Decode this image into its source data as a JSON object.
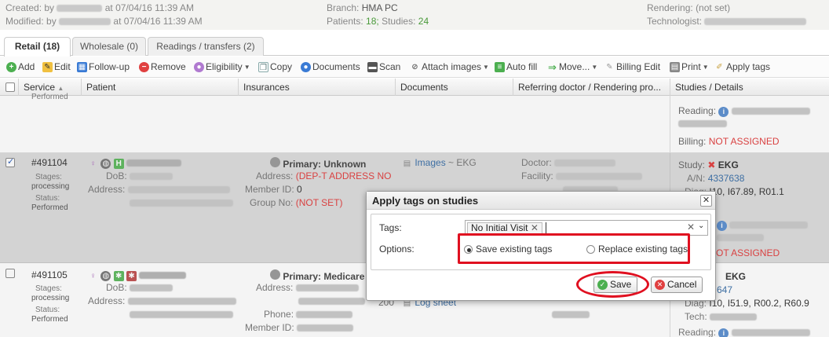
{
  "header": {
    "created_label": "Created:",
    "created_by": "by",
    "created_date": "at 07/04/16 11:39 AM",
    "modified_label": "Modified:",
    "modified_by": "by",
    "modified_date": "at 07/04/16 11:39 AM",
    "branch_label": "Branch:",
    "branch_value": "HMA PC",
    "patients_label": "Patients:",
    "patients_value": "18;",
    "studies_label": "Studies:",
    "studies_value": "24",
    "rendering_label": "Rendering:",
    "rendering_value": "(not set)",
    "technologist_label": "Technologist:"
  },
  "tabs": [
    {
      "label": "Retail (18)"
    },
    {
      "label": "Wholesale (0)"
    },
    {
      "label": "Readings / transfers (2)"
    }
  ],
  "toolbar": {
    "add": "Add",
    "edit": "Edit",
    "followup": "Follow-up",
    "remove": "Remove",
    "eligibility": "Eligibility",
    "copy": "Copy",
    "documents": "Documents",
    "scan": "Scan",
    "attach": "Attach images",
    "autofill": "Auto fill",
    "move": "Move...",
    "billing": "Billing Edit",
    "print": "Print",
    "applytags": "Apply tags"
  },
  "grid": {
    "columns": [
      "Service",
      "Patient",
      "Insurances",
      "Documents",
      "Referring doctor / Rendering pro...",
      "Studies / Details"
    ]
  },
  "row0": {
    "status_partial": "Performed",
    "reading_label": "Reading:",
    "billing_label": "Billing:",
    "billing_value": "NOT ASSIGNED"
  },
  "row1": {
    "id": "#491104",
    "stages_label": "Stages:",
    "stages_value": "processing",
    "status_label": "Status:",
    "status_value": "Performed",
    "dob_label": "DoB:",
    "address_label": "Address:",
    "ins_primary": "Primary: Unknown",
    "ins_address_label": "Address:",
    "ins_address_value": "(DEP-T ADDRESS NO",
    "ins_member_label": "Member ID:",
    "ins_member_value": "0",
    "ins_group_label": "Group No:",
    "ins_group_value": "(NOT SET)",
    "doc_images": "Images",
    "doc_ekg": "~ EKG",
    "doctor_label": "Doctor:",
    "facility_label": "Facility:",
    "study_label": "Study:",
    "study_value": "EKG",
    "an_label": "A/N:",
    "an_value": "4337638",
    "diag_label": "Diag:",
    "diag_value": "I10, I67.89, R01.1",
    "not_assigned": "OT ASSIGNED"
  },
  "row2": {
    "id": "#491105",
    "stages_label": "Stages:",
    "stages_value": "processing",
    "status_label": "Status:",
    "status_value": "Performed",
    "dob_label": "DoB:",
    "address_label": "Address:",
    "ins_primary": "Primary: Medicare",
    "ins_address_label": "Address:",
    "ins_phone_label": "Phone:",
    "ins_member_label": "Member ID:",
    "doc_logsheet": "Log sheet",
    "doc_partial": "200",
    "study_value": "EKG",
    "an_value": "647",
    "diag_label": "Diag:",
    "diag_value": "I10, I51.9, R00.2, R60.9",
    "tech_label": "Tech:",
    "reading_label": "Reading:"
  },
  "dialog": {
    "title": "Apply tags on studies",
    "tags_label": "Tags:",
    "tag_chip": "No Initial Visit",
    "options_label": "Options:",
    "opt_save": "Save existing tags",
    "opt_replace": "Replace existing tags",
    "save": "Save",
    "cancel": "Cancel"
  }
}
